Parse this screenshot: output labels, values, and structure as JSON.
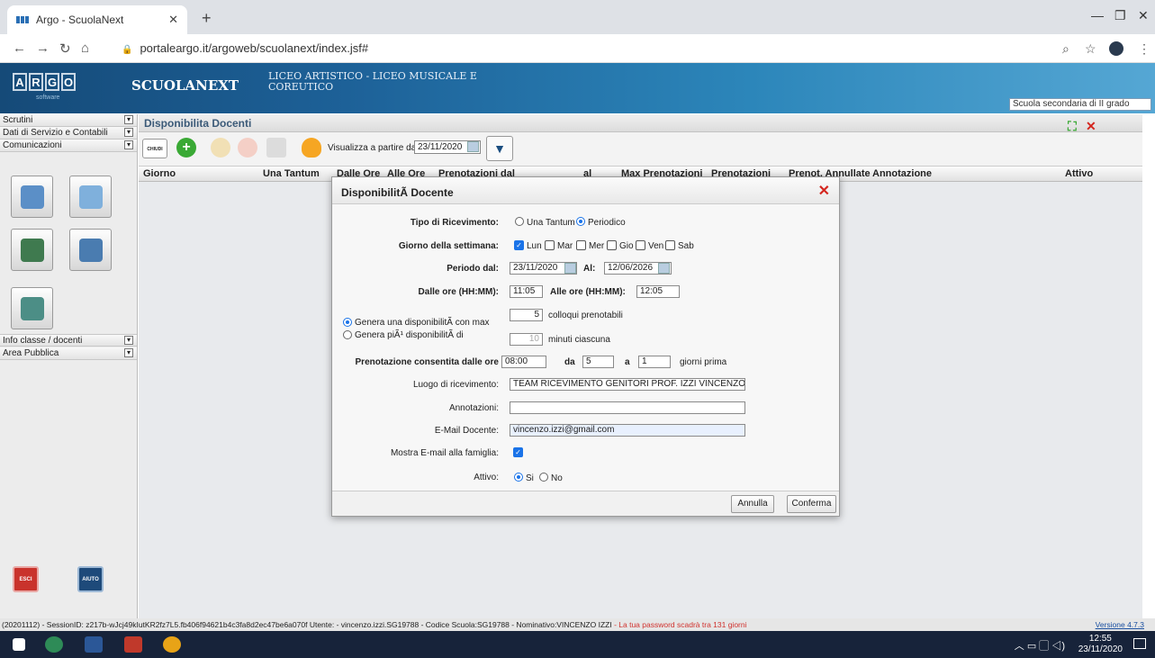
{
  "browser": {
    "tab_title": "Argo - ScuolaNext",
    "url": "portaleargo.it/argoweb/scuolanext/index.jsf#"
  },
  "header": {
    "logo_letters": [
      "A",
      "R",
      "G",
      "O"
    ],
    "logo_sub": "software",
    "app_name": "SCUOLANEXT",
    "school_name": "LICEO ARTISTICO - LICEO MUSICALE E COREUTICO",
    "school_type": "Scuola secondaria di II grado"
  },
  "sidebar": {
    "sections": [
      "Scrutini",
      "Dati di Servizio e Contabili",
      "Comunicazioni"
    ],
    "sections_bottom": [
      "Info classe / docenti",
      "Area Pubblica"
    ],
    "esci_label": "ESCI",
    "aiuto_label": "AIUTO"
  },
  "panel": {
    "title": "Disponibilita Docenti",
    "chiudi_label": "CHIUDI",
    "visualizza_label": "Visualizza a partire dal:",
    "visualizza_value": "23/11/2020",
    "columns": [
      "Giorno",
      "Una Tantum",
      "Dalle Ore",
      "Alle Ore",
      "Prenotazioni dal",
      "al",
      "Max Prenotazioni",
      "Prenotazioni",
      "Prenot. Annullate",
      "Annotazione",
      "Attivo"
    ]
  },
  "modal": {
    "title": "DisponibilitÃ  Docente",
    "tipo_label": "Tipo di Ricevimento:",
    "tipo_options": [
      "Una Tantum",
      "Periodico"
    ],
    "tipo_selected": "Periodico",
    "giorno_label": "Giorno della settimana:",
    "giorni": [
      "Lun",
      "Mar",
      "Mer",
      "Gio",
      "Ven",
      "Sab"
    ],
    "giorni_checked": [
      "Lun"
    ],
    "periodo_label": "Periodo dal:",
    "periodo_dal": "23/11/2020",
    "al_label": "Al:",
    "periodo_al": "12/06/2026",
    "dalle_label": "Dalle ore (HH:MM):",
    "dalle_value": "11:05",
    "alle_label": "Alle ore (HH:MM):",
    "alle_value": "12:05",
    "genera_max_label": "Genera una disponibilitÃ  con max",
    "genera_max_value": "5",
    "genera_max_suffix": "colloqui prenotabili",
    "genera_piu_label": "Genera piÃ¹ disponibilitÃ  di",
    "genera_piu_value": "10",
    "genera_piu_suffix": "minuti ciascuna",
    "prenot_label": "Prenotazione consentita dalle ore",
    "prenot_ore": "08:00",
    "da_label": "da",
    "da_value": "5",
    "a_label": "a",
    "a_value": "1",
    "giorni_prima": "giorni prima",
    "luogo_label": "Luogo di ricevimento:",
    "luogo_value": "TEAM RICEVIMENTO GENITORI PROF. IZZI VINCENZO",
    "annotazioni_label": "Annotazioni:",
    "annotazioni_value": "",
    "email_label": "E-Mail Docente:",
    "email_value": "vincenzo.izzi@gmail.com",
    "mostra_label": "Mostra E-mail alla famiglia:",
    "mostra_checked": true,
    "attivo_label": "Attivo:",
    "attivo_options": [
      "Si",
      "No"
    ],
    "attivo_selected": "Si",
    "annulla_label": "Annulla",
    "conferma_label": "Conferma"
  },
  "status": {
    "text": "(20201112) - SessionID: z217b-wJcj49kIutKR2fz7L5.fb406f94621b4c3fa8d2ec47be6a070f Utente: - vincenzo.izzi.SG19788 - Codice Scuola:SG19788 - Nominativo:VINCENZO IZZI",
    "warning": "- La tua password scadrà tra 131 giorni",
    "version": "Versione 4.7.3"
  },
  "taskbar": {
    "time": "12:55",
    "date": "23/11/2020"
  }
}
